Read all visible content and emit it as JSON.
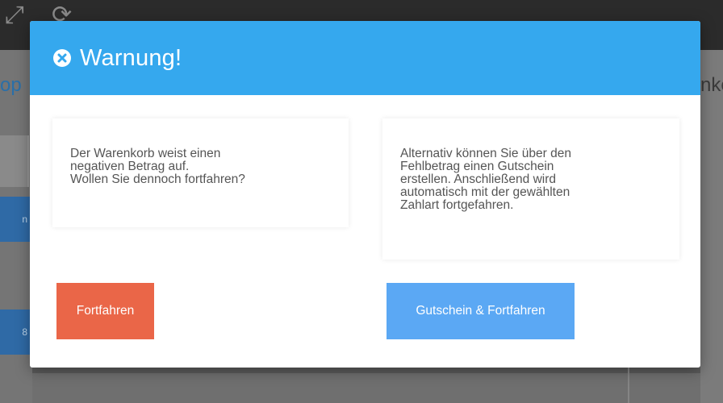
{
  "background": {
    "left_title": "op",
    "left_button_1": "n",
    "left_button_2": "8",
    "right_title": "nke"
  },
  "modal": {
    "title": "Warnung!",
    "close_icon": "close-circle-icon",
    "left_message": "Der Warenkorb weist einen\nnegativen Betrag auf.\nWollen Sie dennoch fortfahren?",
    "right_message": "Alternativ können Sie über den\nFehlbetrag einen Gutschein\nerstellen. Anschließend wird\nautomatisch mit der gewählten\nZahlart fortgefahren.",
    "buttons": {
      "continue_label": "Fortfahren",
      "voucher_label": "Gutschein & Fortfahren"
    }
  },
  "colors": {
    "header": "#35a8ee",
    "continue_button": "#ea6648",
    "voucher_button": "#5ba8f4"
  }
}
